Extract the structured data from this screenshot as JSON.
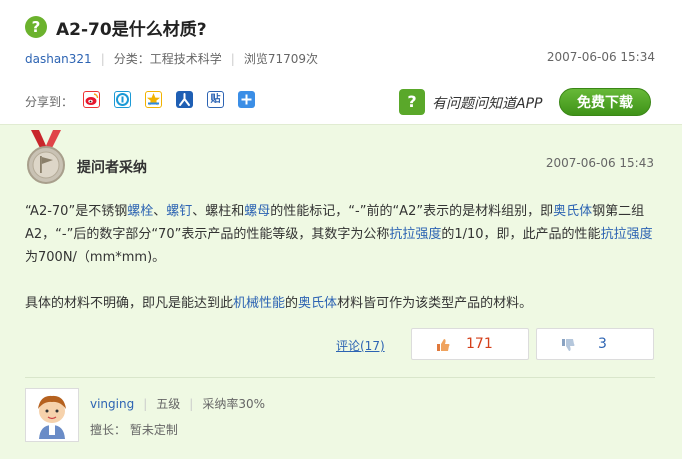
{
  "question": {
    "icon_text": "?",
    "title": "A2-70是什么材质?",
    "author": "dashan321",
    "category": "分类：工程技术科学",
    "views": "浏览71709次",
    "date": "2007-06-06 15:34"
  },
  "share": {
    "label": "分享到：",
    "icons": [
      "weibo-icon",
      "qzone-icon",
      "qq-space-icon",
      "renren-icon",
      "tieba-icon",
      "more-icon"
    ]
  },
  "app_promo": {
    "text": "有问题问知道APP",
    "button_label": "免费下载"
  },
  "answer": {
    "accepted_label": "提问者采纳",
    "date": "2007-06-06 15:43",
    "p1": {
      "t1": "“A2-70”是不锈钢",
      "l1": "螺栓",
      "t2": "、",
      "l2": "螺钉",
      "t3": "、螺柱和",
      "l3": "螺母",
      "t4": "的性能标记，“-”前的“A2”表示的是材料组别，即",
      "l4": "奥氏体",
      "t5": "钢第二组A2，“-”后的数字部分“70”表示产品的性能等级，其数字为公称",
      "l5": "抗拉强度",
      "t6": "的1/10，即，此产品的性能",
      "l6": "抗拉强度",
      "t7": "为700N/（mm*mm)。"
    },
    "p2": {
      "t1": "具体的材料不明确，即凡是能达到此",
      "l1": "机械性能",
      "t2": "的",
      "l2": "奥氏体",
      "t3": "材料皆可作为该类型产品的材料。"
    },
    "comments_label": "评论(17)",
    "upvotes": "171",
    "downvotes": "3"
  },
  "answerer": {
    "name": "vinging",
    "level": "五级",
    "accept_rate": "采纳率30%",
    "specialty": "擅长：   暂未定制"
  }
}
